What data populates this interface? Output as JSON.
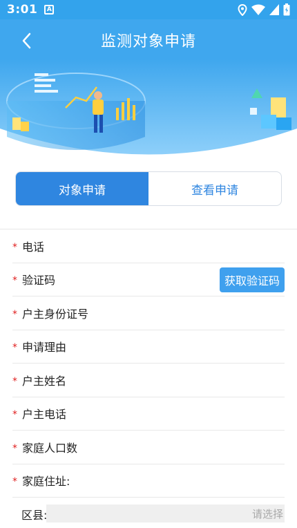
{
  "status_bar": {
    "time": "3:01",
    "app_badge": "A"
  },
  "header": {
    "title": "监测对象申请"
  },
  "tabs": [
    {
      "label": "对象申请",
      "active": true
    },
    {
      "label": "查看申请",
      "active": false
    }
  ],
  "form": {
    "fields": [
      {
        "label": "电话",
        "required": true
      },
      {
        "label": "验证码",
        "required": true
      },
      {
        "label": "户主身份证号",
        "required": true
      },
      {
        "label": "申请理由",
        "required": true
      },
      {
        "label": "户主姓名",
        "required": true
      },
      {
        "label": "户主电话",
        "required": true
      },
      {
        "label": "家庭人口数",
        "required": true
      },
      {
        "label": "家庭住址:",
        "required": true
      }
    ],
    "get_code_label": "获取验证码",
    "district": {
      "label": "区县:",
      "placeholder": "请选择"
    }
  },
  "colors": {
    "primary": "#2f86e0",
    "header": "#3fa7ee",
    "required": "#e02020"
  }
}
